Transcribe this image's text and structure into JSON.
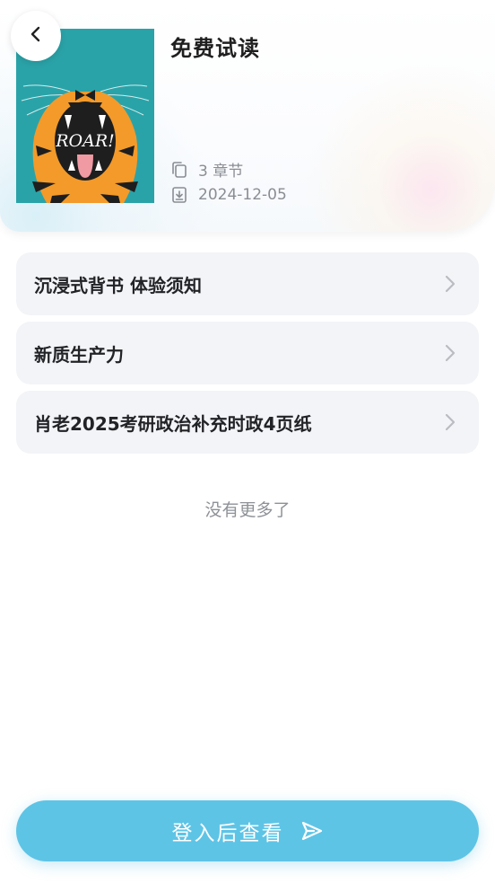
{
  "header": {
    "title": "免费试读",
    "chapters_text": "3 章节",
    "date": "2024-12-05",
    "cover_text": "ROAR!",
    "cover_colors": {
      "background": "#2aa3a8",
      "tiger_orange": "#f39a2a",
      "mouth": "#1e1e1e",
      "tongue": "#f09aa4"
    }
  },
  "chapters": [
    {
      "label": "沉浸式背书 体验须知"
    },
    {
      "label": "新质生产力"
    },
    {
      "label": "肖老2025考研政治补充时政4页纸"
    }
  ],
  "footer": {
    "no_more": "没有更多了"
  },
  "cta": {
    "label": "登入后查看",
    "color": "#5ec4e6"
  },
  "icons": {
    "back": "chevron-left-icon",
    "chapters": "copy-icon",
    "date": "download-icon",
    "chevron": "chevron-right-icon",
    "send": "send-icon"
  }
}
